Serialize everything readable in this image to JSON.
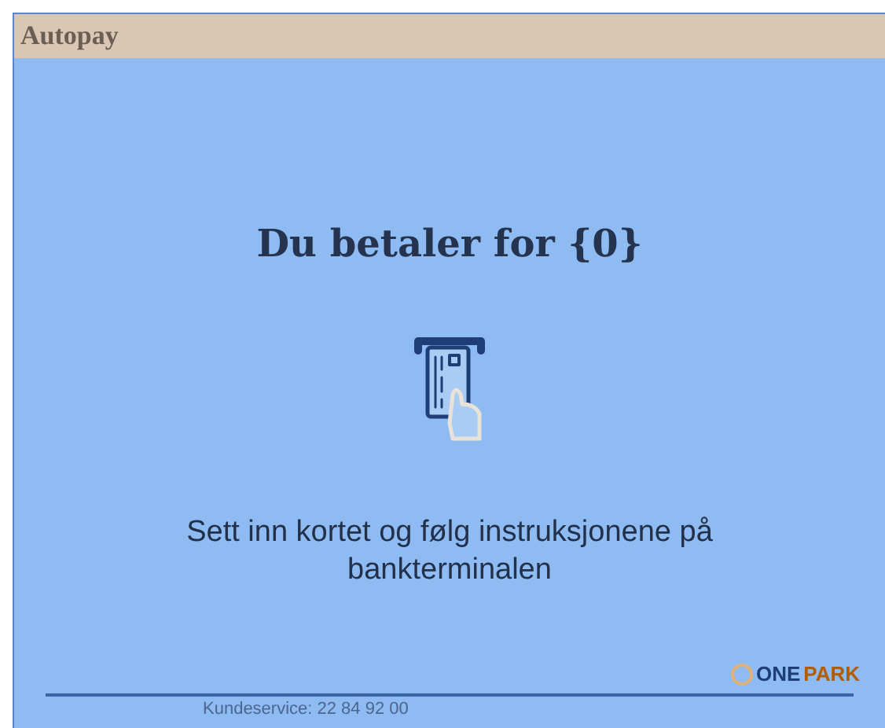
{
  "header": {
    "brand": "Autopay"
  },
  "main": {
    "title": "Du betaler for {0}",
    "instruction": "Sett inn kortet og følg instruksjonene på bankterminalen"
  },
  "footer": {
    "contact": "Kundeservice: 22 84 92 00",
    "logo": {
      "part_1": "ONE",
      "part_2": "PARK"
    }
  }
}
